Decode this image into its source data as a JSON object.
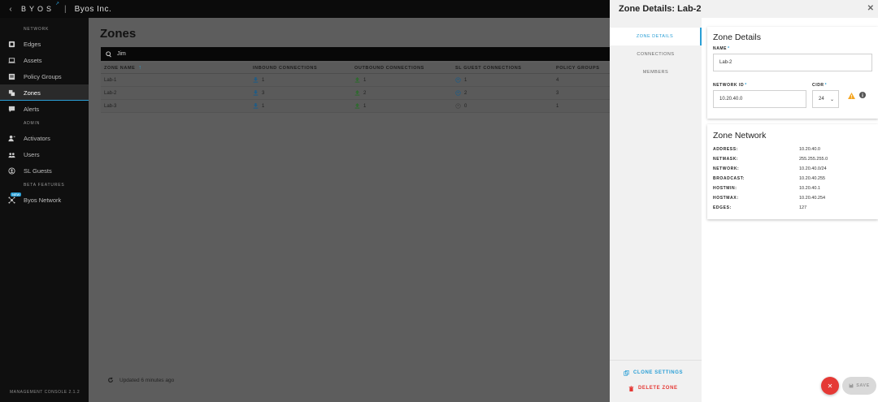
{
  "topbar": {
    "back_icon": "chevron-left-icon",
    "logo": "BYOS",
    "org": "Byos Inc."
  },
  "sidebar": {
    "sections": [
      {
        "label": "NETWORK",
        "items": [
          {
            "label": "Edges",
            "icon": "edges-icon"
          },
          {
            "label": "Assets",
            "icon": "laptop-icon"
          },
          {
            "label": "Policy Groups",
            "icon": "policy-icon"
          },
          {
            "label": "Zones",
            "icon": "zones-icon",
            "active": true
          },
          {
            "label": "Alerts",
            "icon": "alert-icon"
          }
        ]
      },
      {
        "label": "ADMIN",
        "items": [
          {
            "label": "Activators",
            "icon": "activator-icon"
          },
          {
            "label": "Users",
            "icon": "users-icon"
          },
          {
            "label": "SL Guests",
            "icon": "guests-icon"
          }
        ]
      },
      {
        "label": "BETA FEATURES",
        "items": [
          {
            "label": "Byos Network",
            "icon": "network-icon",
            "badge": "NEW"
          }
        ]
      }
    ],
    "version": "MANAGEMENT CONSOLE 2.1.2"
  },
  "main": {
    "title": "Zones",
    "search": {
      "value": "Jim"
    },
    "columns": [
      "ZONE NAME",
      "INBOUND CONNECTIONS",
      "OUTBOUND CONNECTIONS",
      "SL GUEST CONNECTIONS",
      "POLICY GROUPS"
    ],
    "rows": [
      {
        "name": "Lab-1",
        "inbound": "1",
        "outbound": "1",
        "guest": "1",
        "policy": "4"
      },
      {
        "name": "Lab-2",
        "inbound": "3",
        "outbound": "2",
        "guest": "2",
        "policy": "3"
      },
      {
        "name": "Lab-3",
        "inbound": "1",
        "outbound": "1",
        "guest": "0",
        "policy": "1"
      }
    ],
    "footer": "Updated 6 minutes ago"
  },
  "drawer": {
    "title": "Zone Details: Lab-2",
    "nav": [
      "ZONE DETAILS",
      "CONNECTIONS",
      "MEMBERS"
    ],
    "clone_label": "CLONE SETTINGS",
    "delete_label": "DELETE ZONE",
    "details": {
      "heading": "Zone Details",
      "name_label": "NAME",
      "name_value": "Lab-2",
      "network_id_label": "NETWORK ID",
      "network_id_value": "10.20.40.0",
      "cidr_label": "CIDR",
      "cidr_value": "24",
      "required_mark": "*"
    },
    "network": {
      "heading": "Zone Network",
      "rows": [
        {
          "k": "ADDRESS:",
          "v": "10.20.40.0"
        },
        {
          "k": "NETMASK:",
          "v": "255.255.255.0"
        },
        {
          "k": "NETWORK:",
          "v": "10.20.40.0/24"
        },
        {
          "k": "BROADCAST:",
          "v": "10.20.40.255"
        },
        {
          "k": "HOSTMIN:",
          "v": "10.20.40.1"
        },
        {
          "k": "HOSTMAX:",
          "v": "10.20.40.254"
        },
        {
          "k": "EDGES:",
          "v": "127"
        }
      ]
    },
    "save_label": "SAVE",
    "close_icon": "close-icon",
    "colors": {
      "accent": "#2a9fd6",
      "danger": "#e53935",
      "warning": "#f5a623"
    }
  }
}
